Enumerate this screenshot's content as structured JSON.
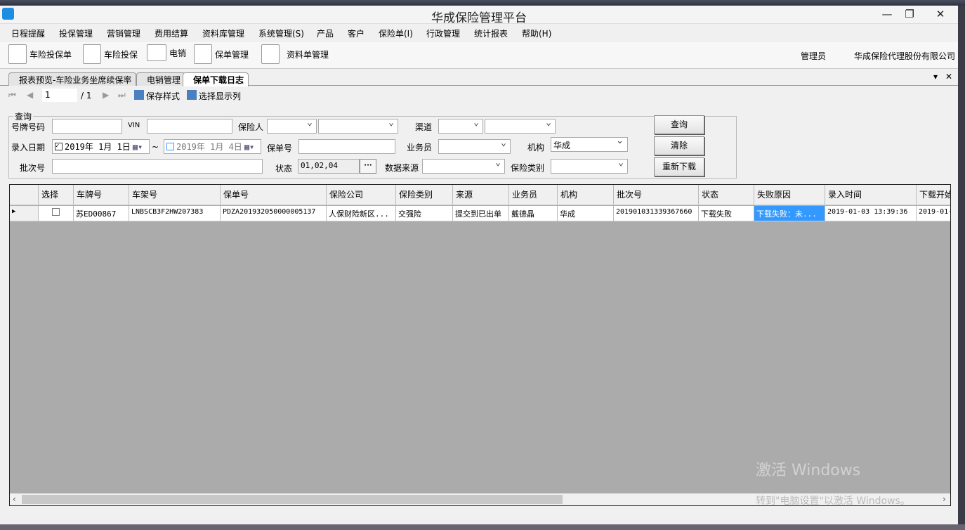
{
  "window": {
    "title": "华成保险管理平台",
    "minimize": "—",
    "maximize": "❐",
    "close": "✕"
  },
  "menu": [
    "日程提醒",
    "投保管理",
    "营销管理",
    "费用结算",
    "资料库管理",
    "系统管理(S)",
    "产品",
    "客户",
    "保险单(I)",
    "行政管理",
    "统计报表",
    "帮助(H)"
  ],
  "toolbar": {
    "items": [
      "车险投保单",
      "车险投保",
      "电销",
      "保单管理",
      "资料单管理"
    ],
    "user": "管理员",
    "company": "华成保险代理股份有限公司"
  },
  "tabs": [
    "报表预览-车险业务坐席续保率",
    "电销管理",
    "保单下载日志"
  ],
  "tab_controls": {
    "dropdown": "▾",
    "close": "✕"
  },
  "pager": {
    "current": "1",
    "total": "/ 1",
    "save_style": "保存样式",
    "select_columns": "选择显示列"
  },
  "query": {
    "legend": "查询",
    "plate_label": "号牌号码",
    "plate_value": "",
    "vin_label": "VIN",
    "vin_value": "",
    "insured_label": "保险人",
    "channel_label": "渠道",
    "entry_date_label": "录入日期",
    "date_from": "2019年 1月 1日",
    "date_sep": "~",
    "date_to": "2019年 1月 4日",
    "policy_label": "保单号",
    "salesman_label": "业务员",
    "org_label": "机构",
    "org_value": "华成",
    "batch_label": "批次号",
    "status_label": "状态",
    "status_value": "01,02,04",
    "status_button": "···",
    "source_label": "数据来源",
    "category_label": "保险类别",
    "search_button": "查询",
    "clear_button": "清除",
    "redownload_button": "重新下载"
  },
  "grid": {
    "columns": [
      "选择",
      "车牌号",
      "车架号",
      "保单号",
      "保险公司",
      "保险类别",
      "来源",
      "业务员",
      "机构",
      "批次号",
      "状态",
      "失败原因",
      "录入时间",
      "下载开始"
    ],
    "rows": [
      [
        "",
        "苏ED00867",
        "LNBSCB3F2HW207383",
        "PDZA201932050000005137",
        "人保财险新区...",
        "交强险",
        "提交到已出单",
        "戴德晶",
        "华成",
        "201901031339367660",
        "下载失败",
        "下载失败：未...",
        "2019-01-03 13:39:36",
        "2019-01-"
      ]
    ]
  },
  "watermark": {
    "line1": "激活 Windows",
    "line2": "转到\"电脑设置\"以激活 Windows。"
  }
}
